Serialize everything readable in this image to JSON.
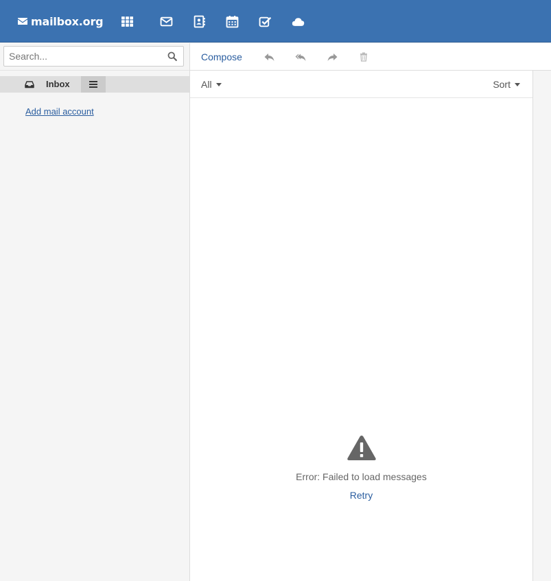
{
  "brand": {
    "name": "mailbox.org",
    "icon": "envelope-icon"
  },
  "topbar": {
    "color": "#3b72b1",
    "apps": [
      {
        "name": "app-launcher",
        "icon": "grid-icon"
      },
      {
        "name": "mail",
        "icon": "envelope-icon"
      },
      {
        "name": "contacts",
        "icon": "address-book-icon"
      },
      {
        "name": "calendar",
        "icon": "calendar-icon"
      },
      {
        "name": "tasks",
        "icon": "checkbox-icon"
      },
      {
        "name": "drive",
        "icon": "cloud-icon"
      }
    ]
  },
  "search": {
    "placeholder": "Search...",
    "value": ""
  },
  "folders": {
    "items": [
      {
        "label": "Inbox",
        "icon": "inbox-icon"
      }
    ],
    "add_account": "Add mail account"
  },
  "toolbar": {
    "compose": "Compose",
    "icons": [
      "reply-icon",
      "reply-all-icon",
      "forward-icon",
      "trash-icon"
    ]
  },
  "list": {
    "filter": "All",
    "sort": "Sort",
    "error": "Error: Failed to load messages",
    "retry": "Retry"
  },
  "colors": {
    "accent": "#2a5d9f",
    "topbar": "#3b72b1",
    "icon_gray": "#999999"
  }
}
